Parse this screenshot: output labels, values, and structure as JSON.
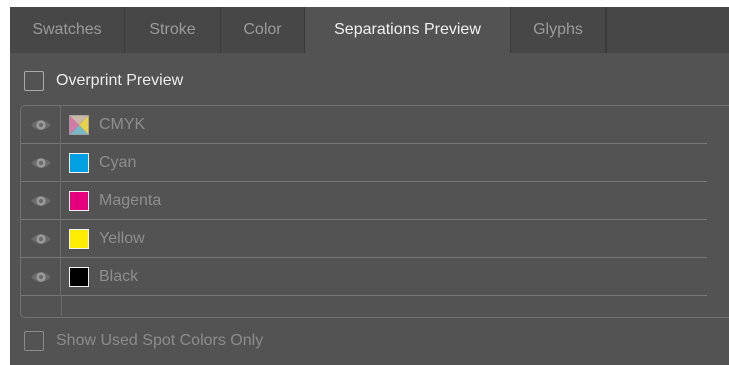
{
  "tabs": [
    {
      "label": "Swatches",
      "active": false
    },
    {
      "label": "Stroke",
      "active": false
    },
    {
      "label": "Color",
      "active": false
    },
    {
      "label": "Separations Preview",
      "active": true
    },
    {
      "label": "Glyphs",
      "active": false
    }
  ],
  "overprint_preview": {
    "label": "Overprint Preview",
    "checked": false
  },
  "separations": [
    {
      "name": "CMYK",
      "swatch": "cmyk",
      "visible": true
    },
    {
      "name": "Cyan",
      "swatch": "#00a0e3",
      "visible": true
    },
    {
      "name": "Magenta",
      "swatch": "#e6007e",
      "visible": true
    },
    {
      "name": "Yellow",
      "swatch": "#ffed00",
      "visible": true
    },
    {
      "name": "Black",
      "swatch": "#000000",
      "visible": true
    }
  ],
  "show_used_spot_colors": {
    "label": "Show Used Spot Colors Only",
    "checked": false,
    "enabled": false
  },
  "colors": {
    "panel_bg": "#535353",
    "tabbar_bg": "#424242",
    "active_tab_bg": "#535353"
  }
}
